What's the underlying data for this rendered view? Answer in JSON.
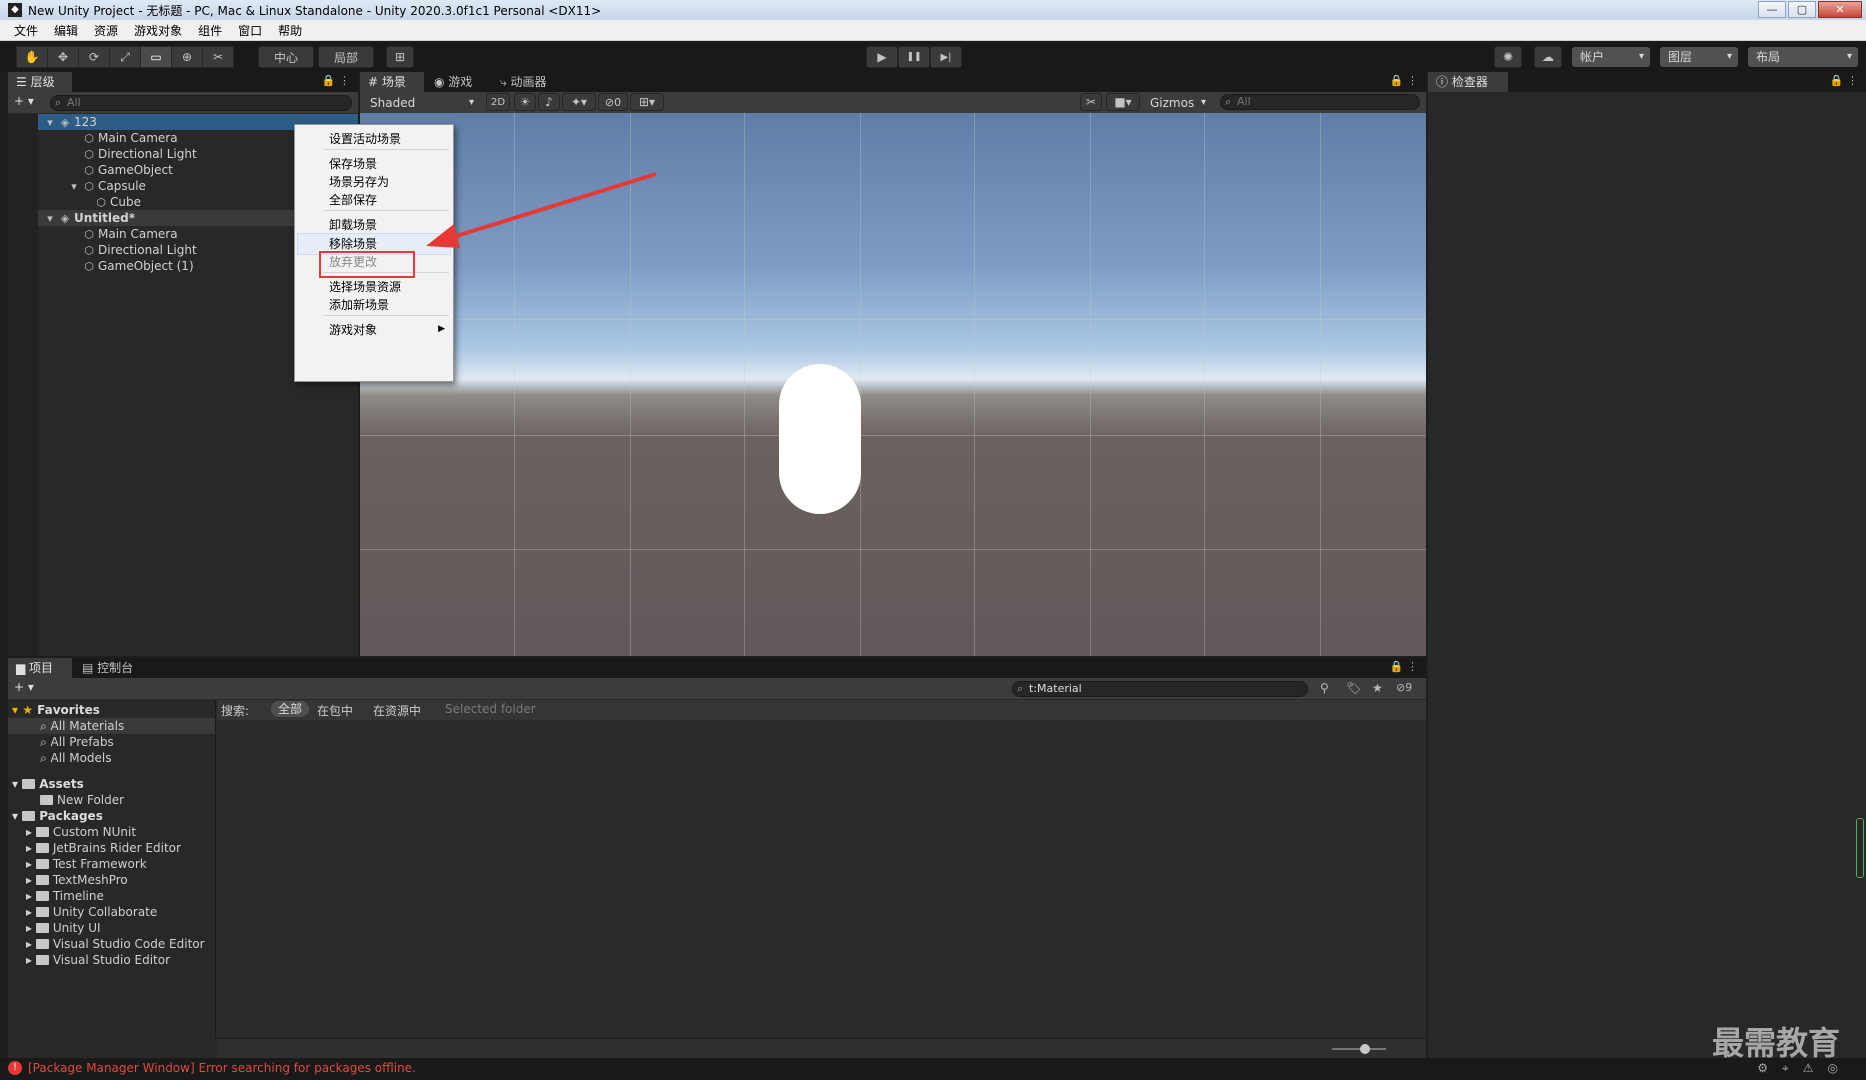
{
  "window": {
    "title": "New Unity Project - 无标题 - PC, Mac & Linux Standalone - Unity 2020.3.0f1c1 Personal <DX11>",
    "app_icon": "unity-icon",
    "buttons": {
      "minimize": "—",
      "maximize": "▢",
      "close": "✕"
    }
  },
  "menubar": [
    "文件",
    "编辑",
    "资源",
    "游戏对象",
    "组件",
    "窗口",
    "帮助"
  ],
  "toolbar": {
    "tools": [
      "✋",
      "✥",
      "⟳",
      "⤢",
      "▭",
      "⊕",
      "✂"
    ],
    "pivot_label": "中心",
    "space_label": "局部",
    "grid_snap": "⊞",
    "play": "▶",
    "pause": "❚❚",
    "step": "▶|",
    "collab": "✺",
    "cloud": "☁",
    "account_label": "帐户",
    "layers_label": "图层",
    "layout_label": "布局"
  },
  "hierarchy": {
    "tab_label": "层级",
    "add_label": "+ ▾",
    "search_placeholder": "All",
    "rows": [
      {
        "label": "123",
        "indent": 0,
        "type": "scene",
        "selected": true
      },
      {
        "label": "Main Camera",
        "indent": 2,
        "type": "object"
      },
      {
        "label": "Directional Light",
        "indent": 2,
        "type": "object"
      },
      {
        "label": "GameObject",
        "indent": 2,
        "type": "object"
      },
      {
        "label": "Capsule",
        "indent": 2,
        "type": "object",
        "expanded": true
      },
      {
        "label": "Cube",
        "indent": 3,
        "type": "object"
      },
      {
        "label": "Untitled*",
        "indent": 0,
        "type": "scene-unloaded"
      },
      {
        "label": "Main Camera",
        "indent": 2,
        "type": "object"
      },
      {
        "label": "Directional Light",
        "indent": 2,
        "type": "object"
      },
      {
        "label": "GameObject (1)",
        "indent": 2,
        "type": "object"
      }
    ]
  },
  "context_menu": {
    "items": [
      {
        "label": "设置活动场景",
        "enabled": true
      },
      {
        "label": "保存场景",
        "enabled": true
      },
      {
        "label": "场景另存为",
        "enabled": true
      },
      {
        "label": "全部保存",
        "enabled": true
      },
      {
        "label": "卸载场景",
        "enabled": true
      },
      {
        "label": "移除场景",
        "enabled": true,
        "highlighted": true
      },
      {
        "label": "放弃更改",
        "enabled": false
      },
      {
        "label": "选择场景资源",
        "enabled": true
      },
      {
        "label": "添加新场景",
        "enabled": true
      },
      {
        "label": "游戏对象",
        "enabled": true,
        "submenu": true
      }
    ]
  },
  "scene_panel": {
    "tabs": [
      "场景",
      "游戏",
      "动画器"
    ],
    "shading_mode": "Shaded",
    "mode_2d": "2D",
    "hidden_count": "0",
    "gizmos_label": "Gizmos",
    "search_placeholder": "All"
  },
  "inspector": {
    "tab_label": "检查器"
  },
  "project": {
    "tabs": [
      "项目",
      "控制台"
    ],
    "search_value": "t:Material",
    "hidden_count": "9",
    "filter_label": "搜索:",
    "filters": [
      "全部",
      "在包中",
      "在资源中",
      "Selected folder"
    ],
    "favorites": {
      "label": "Favorites",
      "items": [
        "All Materials",
        "All Prefabs",
        "All Models"
      ]
    },
    "assets": {
      "label": "Assets",
      "items": [
        "New Folder"
      ]
    },
    "packages": {
      "label": "Packages",
      "items": [
        "Custom NUnit",
        "JetBrains Rider Editor",
        "Test Framework",
        "TextMeshPro",
        "Timeline",
        "Unity Collaborate",
        "Unity UI",
        "Visual Studio Code Editor",
        "Visual Studio Editor"
      ]
    }
  },
  "status": {
    "message": "[Package Manager Window] Error searching for packages offline.",
    "error_color": "#e53935"
  },
  "watermark": "最需教育",
  "colors": {
    "selection": "#2c5d87",
    "annotation_red": "#e53935",
    "panel_bg": "#282828"
  }
}
